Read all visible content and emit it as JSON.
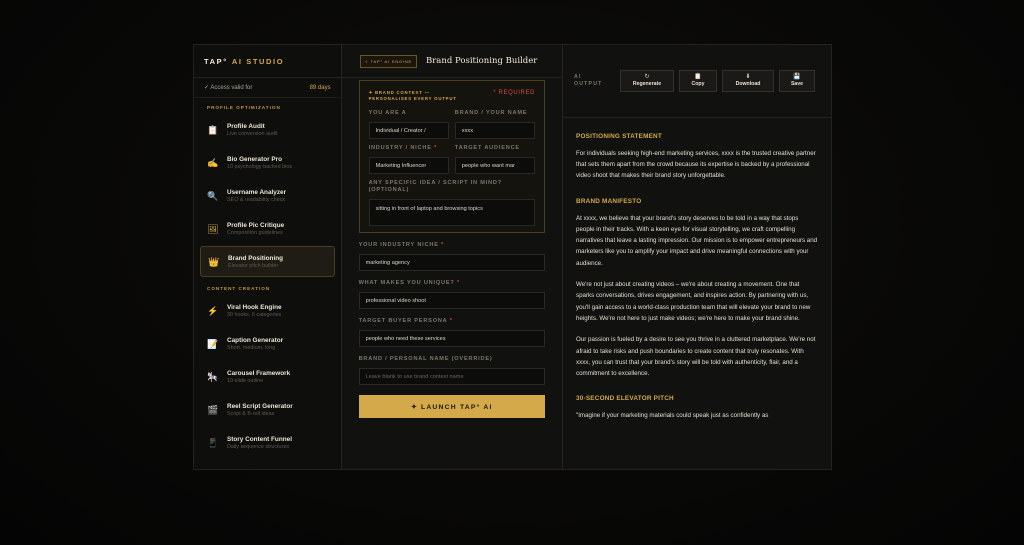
{
  "sidebar": {
    "brand_main": "TAP°",
    "brand_sub": "AI STUDIO",
    "access_label": "✓ Access valid for",
    "access_days": "89 days",
    "section_profile": "PROFILE OPTIMIZATION",
    "section_content": "CONTENT CREATION",
    "items": [
      {
        "title": "Profile Audit",
        "sub": "Live conversion audit",
        "icon": "📋"
      },
      {
        "title": "Bio Generator Pro",
        "sub": "10 psychology-backed bios",
        "icon": "✍"
      },
      {
        "title": "Username Analyzer",
        "sub": "SEO & readability check",
        "icon": "🔍"
      },
      {
        "title": "Profile Pic Critique",
        "sub": "Composition guidelines",
        "icon": "🖼"
      },
      {
        "title": "Brand Positioning",
        "sub": "Elevator pitch builder",
        "icon": "👑"
      },
      {
        "title": "Viral Hook Engine",
        "sub": "30 hooks, 6 categories",
        "icon": "⚡"
      },
      {
        "title": "Caption Generator",
        "sub": "Short, medium, long",
        "icon": "📝"
      },
      {
        "title": "Carousel Framework",
        "sub": "10-slide outline",
        "icon": "🎠"
      },
      {
        "title": "Reel Script Generator",
        "sub": "Script & B-roll ideas",
        "icon": "🎬"
      },
      {
        "title": "Story Content Funnel",
        "sub": "Daily sequence structures",
        "icon": "📱"
      }
    ]
  },
  "middle": {
    "engine_badge": "✧ TAP° AI ENGINE",
    "title": "Brand Positioning Builder",
    "context": {
      "title_line1": "✦ BRAND CONTEXT —",
      "title_line2": "PERSONALISES EVERY OUTPUT",
      "required": "* REQUIRED",
      "you_are_label": "YOU ARE A",
      "you_are_value": "Individual / Creator /",
      "brand_name_label": "BRAND / YOUR NAME",
      "brand_name_value": "xxxx",
      "industry_label": "INDUSTRY / NICHE",
      "industry_value": "Marketing Influencer",
      "audience_label": "TARGET AUDIENCE",
      "audience_value": "people who want mar",
      "idea_label": "ANY SPECIFIC IDEA / SCRIPT IN MIND? (OPTIONAL)",
      "idea_value": "sitting in front of laptop and browsing topics"
    },
    "niche_label": "YOUR INDUSTRY NICHE",
    "niche_value": "marketing agency",
    "unique_label": "WHAT MAKES YOU UNIQUE?",
    "unique_value": "professional video shoot",
    "persona_label": "TARGET BUYER PERSONA",
    "persona_value": "people who need these services",
    "override_label": "BRAND / PERSONAL NAME (OVERRIDE)",
    "override_placeholder": "Leave blank to use brand context name",
    "launch_label": "✦ LAUNCH TAP° AI"
  },
  "output": {
    "label_line1": "AI",
    "label_line2": "OUTPUT",
    "buttons": [
      {
        "icon": "↻",
        "label": "Regenerate"
      },
      {
        "icon": "📋",
        "label": "Copy"
      },
      {
        "icon": "⬇",
        "label": "Download"
      },
      {
        "icon": "💾",
        "label": "Save"
      }
    ],
    "h1": "POSITIONING STATEMENT",
    "p1": "For individuals seeking high-end marketing services, xxxx is the trusted creative partner that sets them apart from the crowd because its expertise is backed by a professional video shoot that makes their brand story unforgettable.",
    "h2": "BRAND MANIFESTO",
    "p2": "At xxxx, we believe that your brand's story deserves to be told in a way that stops people in their tracks. With a keen eye for visual storytelling, we craft compelling narratives that leave a lasting impression. Our mission is to empower entrepreneurs and marketers like you to amplify your impact and drive meaningful connections with your audience.",
    "p3": "We're not just about creating videos – we're about creating a movement. One that sparks conversations, drives engagement, and inspires action. By partnering with us, you'll gain access to a world-class production team that will elevate your brand to new heights. We're not here to just make videos; we're here to make your brand shine.",
    "p4": "Our passion is fueled by a desire to see you thrive in a cluttered marketplace. We're not afraid to take risks and push boundaries to create content that truly resonates. With xxxx, you can trust that your brand's story will be told with authenticity, flair, and a commitment to excellence.",
    "h3": "30-SECOND ELEVATOR PITCH",
    "p5": "\"Imagine if your marketing materials could speak just as confidently as"
  },
  "colors": {
    "accent": "#d4a94a",
    "required": "#d94a3a",
    "background": "#111110"
  }
}
